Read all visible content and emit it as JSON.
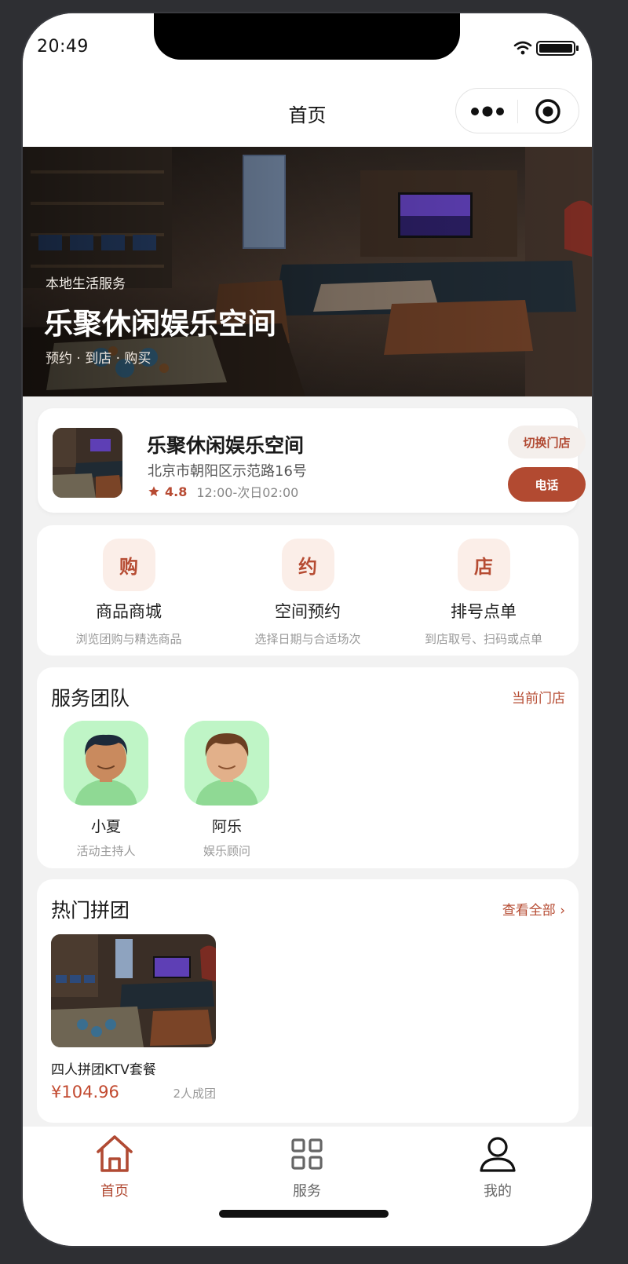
{
  "status": {
    "time": "20:49"
  },
  "nav": {
    "title": "首页"
  },
  "hero": {
    "kicker": "本地生活服务",
    "title": "乐聚休闲娱乐空间",
    "subtitle": "预约 · 到店 · 购买"
  },
  "store": {
    "name": "乐聚休闲娱乐空间",
    "address": "北京市朝阳区示范路16号",
    "rating": "4.8",
    "hours": "12:00-次日02:00",
    "switch_label": "切换门店",
    "call_label": "电话"
  },
  "quick_actions": [
    {
      "badge": "购",
      "label": "商品商城",
      "desc": "浏览团购与精选商品"
    },
    {
      "badge": "约",
      "label": "空间预约",
      "desc": "选择日期与合适场次"
    },
    {
      "badge": "店",
      "label": "排号点单",
      "desc": "到店取号、扫码或点单"
    }
  ],
  "team": {
    "title": "服务团队",
    "link": "当前门店",
    "members": [
      {
        "name": "小夏",
        "role": "活动主持人",
        "avatar": "avatar-dark-hair"
      },
      {
        "name": "阿乐",
        "role": "娱乐顾问",
        "avatar": "avatar-brown-hair"
      }
    ]
  },
  "group_buy": {
    "title": "热门拼团",
    "link": "查看全部 ›",
    "items": [
      {
        "title": "四人拼团KTV套餐",
        "price": "¥104.96",
        "note": "2人成团"
      }
    ]
  },
  "tabbar": [
    {
      "label": "首页",
      "icon": "home-icon",
      "active": true
    },
    {
      "label": "服务",
      "icon": "grid-icon",
      "active": false
    },
    {
      "label": "我的",
      "icon": "user-icon",
      "active": false
    }
  ],
  "colors": {
    "accent": "#b24a31",
    "accent_soft": "#fbeee8",
    "avatar_bg": "#bff5c6"
  }
}
